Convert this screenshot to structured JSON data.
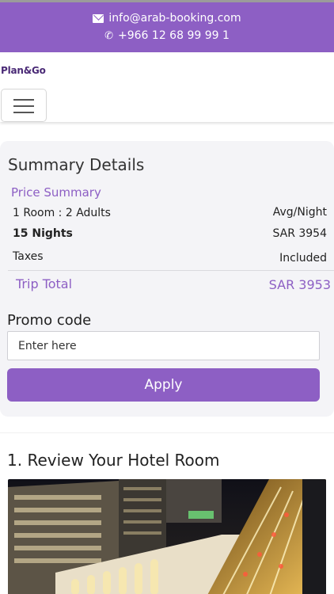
{
  "topbar": {
    "email": "info@arab-booking.com",
    "phone": "+966 12 68 99 99 1",
    "email_icon": "envelope-icon",
    "phone_icon": "phone-icon",
    "background_color": "#8d5fc4"
  },
  "nav": {
    "logo": "Plan&Go",
    "menu_icon": "hamburger-menu-icon"
  },
  "summary": {
    "title": "Summary Details",
    "price_summary_label": "Price Summary",
    "rows": [
      {
        "left": "1 Room : 2 Adults",
        "right": "Avg/Night"
      },
      {
        "left": "15 Nights",
        "right": "SAR 3954"
      },
      {
        "left": "Taxes",
        "right": "Included"
      }
    ],
    "trip_total_label": "Trip Total",
    "trip_total_value": "SAR 3953"
  },
  "promo": {
    "label": "Promo code",
    "placeholder": "Enter here",
    "apply_label": "Apply"
  },
  "review": {
    "title": "1.  Review Your Hotel Room",
    "image_alt": "Hotel exterior at night with busy street traffic"
  },
  "colors": {
    "accent": "#8d5fc4",
    "card_background": "#f4f4f7"
  }
}
